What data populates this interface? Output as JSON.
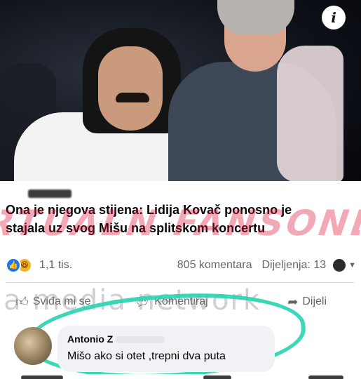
{
  "photo": {
    "info_icon": "info-icon",
    "info_glyph": "i"
  },
  "post": {
    "headline_line1": "Ona je njegova stijena: Lidija Kovač ponosno je",
    "headline_line2": "stajala uz svog Mišu na splitskom koncertu"
  },
  "watermarks": {
    "red_text": "RTUALN FANSONLY",
    "gray_text": "ia media network"
  },
  "stats": {
    "reactions": [
      "like-icon",
      "haha-icon"
    ],
    "reactions_count": "1,1 tis.",
    "comments": "805 komentara",
    "shares": "Dijeljenja: 13"
  },
  "actions": {
    "like": "Sviđa mi se",
    "comment": "Komentiraj",
    "share": "Dijeli"
  },
  "comment": {
    "author": "Antonio Z",
    "text": "Mišo ako si otet ,trepni dva puta"
  },
  "colors": {
    "accent_blue": "#1877f2",
    "highlight_ring": "#27d3b0",
    "watermark_red": "#dc1e3c"
  }
}
